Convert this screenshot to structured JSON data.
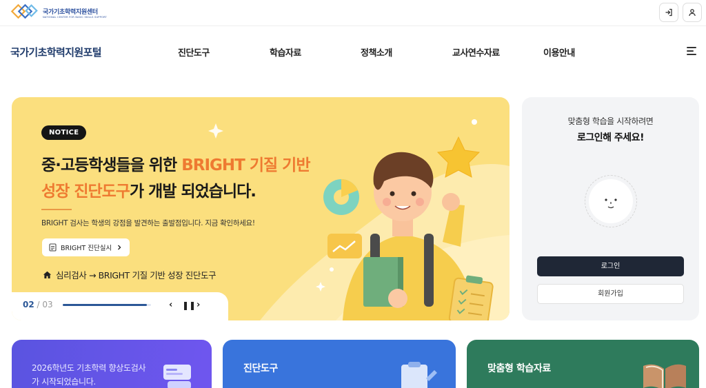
{
  "header": {
    "logo_title": "국가기초학력지원센터",
    "logo_subtitle": "NATIONAL CENTER FOR BASIC SKILLS SUPPORT",
    "login_icon": "login-icon",
    "user_icon": "user-icon"
  },
  "nav": {
    "brand": "국가기초학력지원포털",
    "items": [
      "진단도구",
      "학습자료",
      "정책소개",
      "교사연수자료",
      "이용안내"
    ],
    "menu_icon": "hamburger-icon"
  },
  "hero": {
    "badge": "NOTICE",
    "headline_1a": "중·고등학생들을 위한 ",
    "headline_1b": "BRIGHT 기질 기반",
    "headline_2a": "성장 진단도구",
    "headline_2b": "가 개발 되었습니다.",
    "description": "BRIGHT 검사는 학생의 강점을 발견하는 출발점입니다. 지금 확인하세요!",
    "cta_label": "BRIGHT 진단실시",
    "breadcrumb": "심리검사 → BRIGHT 기질 기반 성장 진단도구",
    "slide_current": "02",
    "slide_total": "/ 03",
    "progress": 0.95,
    "colors": {
      "background": "#fbdf7e",
      "accent": "#ee7a31"
    }
  },
  "login_card": {
    "subtitle": "맞춤형 학습을 시작하려면",
    "title": "로그인해 주세요!",
    "login_label": "로그인",
    "signup_label": "회원가입"
  },
  "cards": [
    {
      "text_1": "2026학년도 기초학력 향상도검사",
      "text_2": "가 시작되었습니다.",
      "color": "#5a54e0"
    },
    {
      "title": "진단도구",
      "color": "#3974dc"
    },
    {
      "title": "맞춤형 학습자료",
      "color": "#2e7b5c"
    }
  ]
}
